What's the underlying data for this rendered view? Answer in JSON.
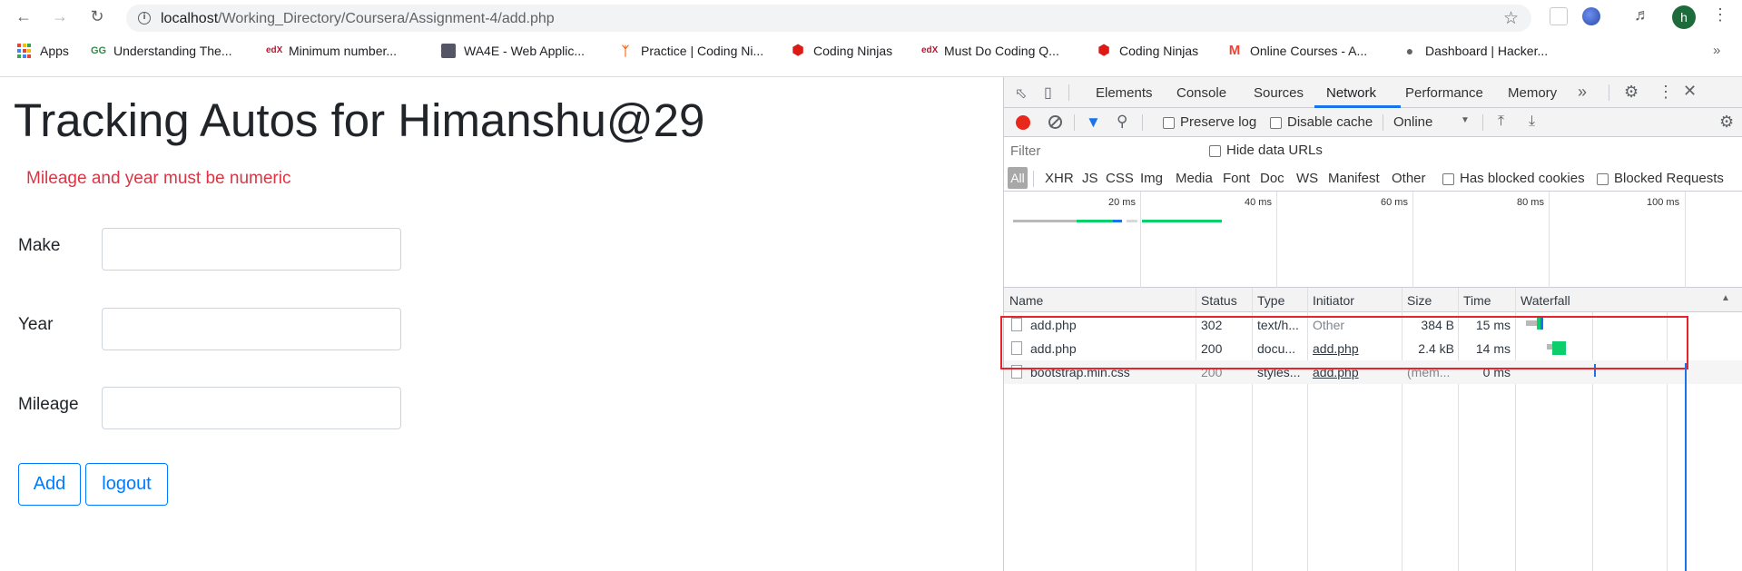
{
  "browser": {
    "url_host": "localhost",
    "url_path": "/Working_Directory/Coursera/Assignment-4/add.php",
    "avatar_letter": "h"
  },
  "bookmarks": [
    {
      "label": "Apps",
      "icon": "apps-grid-icon"
    },
    {
      "label": "Understanding The...",
      "icon": "geeksforgeeks-icon"
    },
    {
      "label": "Minimum number...",
      "icon": "edx-icon"
    },
    {
      "label": "WA4E - Web Applic...",
      "icon": "wa4e-avatar-icon"
    },
    {
      "label": "Practice | Coding Ni...",
      "icon": "coding-ninjas-icon"
    },
    {
      "label": "Coding Ninjas",
      "icon": "angular-icon"
    },
    {
      "label": "Must Do Coding Q...",
      "icon": "edx-icon"
    },
    {
      "label": "Coding Ninjas",
      "icon": "angular-icon"
    },
    {
      "label": "Online Courses - A...",
      "icon": "gmail-icon"
    },
    {
      "label": "Dashboard | Hacker...",
      "icon": "globe-icon"
    }
  ],
  "page": {
    "title": "Tracking Autos for Himanshu@29",
    "error": "Mileage and year must be numeric",
    "fields": [
      {
        "label": "Make",
        "value": ""
      },
      {
        "label": "Year",
        "value": ""
      },
      {
        "label": "Mileage",
        "value": ""
      }
    ],
    "add_label": "Add",
    "logout_label": "logout"
  },
  "devtools": {
    "tabs": [
      "Elements",
      "Console",
      "Sources",
      "Network",
      "Performance",
      "Memory"
    ],
    "active_tab": "Network",
    "toolbar": {
      "preserve_log": "Preserve log",
      "disable_cache": "Disable cache",
      "throttle": "Online"
    },
    "filter_placeholder": "Filter",
    "hide_data_urls": "Hide data URLs",
    "type_filters": [
      "All",
      "XHR",
      "JS",
      "CSS",
      "Img",
      "Media",
      "Font",
      "Doc",
      "WS",
      "Manifest",
      "Other"
    ],
    "has_blocked_cookies": "Has blocked cookies",
    "blocked_requests": "Blocked Requests",
    "timeline_ticks": [
      "20 ms",
      "40 ms",
      "60 ms",
      "80 ms",
      "100 ms"
    ],
    "columns": [
      "Name",
      "Status",
      "Type",
      "Initiator",
      "Size",
      "Time",
      "Waterfall"
    ],
    "requests": [
      {
        "name": "add.php",
        "status": "302",
        "type": "text/h...",
        "initiator": "Other",
        "size": "384 B",
        "time": "15 ms"
      },
      {
        "name": "add.php",
        "status": "200",
        "type": "docu...",
        "initiator": "add.php",
        "size": "2.4 kB",
        "time": "14 ms"
      },
      {
        "name": "bootstrap.min.css",
        "status": "200",
        "type": "styles...",
        "initiator": "add.php",
        "size": "(mem...",
        "time": "0 ms"
      }
    ]
  },
  "colors": {
    "error": "#dc3545",
    "primary": "#007bff",
    "record": "#e8281c",
    "highlight": "#e8232b",
    "waterfall_green": "#0cce6b",
    "waterfall_blue": "#1a73e8"
  }
}
